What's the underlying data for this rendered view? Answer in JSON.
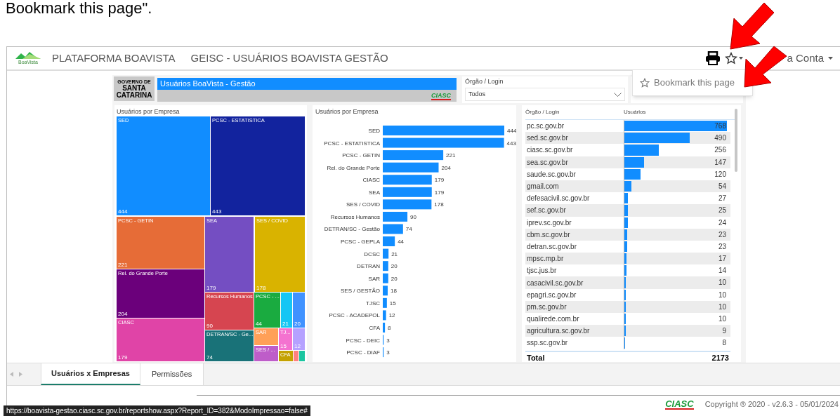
{
  "caption": "Bookmark this page\".",
  "navbar": {
    "logo_caption": "BoaVista",
    "brand": "PLATAFORMA BOAVISTA",
    "title": "GEISC - USUÁRIOS BOAVISTA GESTÃO",
    "account": "a Conta"
  },
  "bookmark_menu": {
    "item": "Bookmark this page"
  },
  "report": {
    "logo_lines": [
      "GOVERNO DE",
      "SANTA",
      "CATARINA"
    ],
    "title": "Usuários BoaVista - Gestão",
    "title_logo": "CIASC",
    "filter": {
      "label": "Órgão / Login",
      "value": "Todos"
    }
  },
  "treemap": {
    "title": "Usuários por Empresa",
    "tiles": [
      {
        "label": "SED",
        "users": "444",
        "color": "#118dff"
      },
      {
        "label": "PCSC - ESTATISTICA",
        "users": "443",
        "color": "#12239e"
      },
      {
        "label": "PCSC - GETIN",
        "users": "221",
        "color": "#e66c37"
      },
      {
        "label": "Rel. do Grande Porte",
        "users": "204",
        "color": "#6b007b"
      },
      {
        "label": "CIASC",
        "users": "179",
        "color": "#e044a7"
      },
      {
        "label": "SEA",
        "users": "179",
        "color": "#744ec2"
      },
      {
        "label": "SES / COVID",
        "users": "178",
        "color": "#d9b300"
      },
      {
        "label": "Recursos Humanos",
        "users": "90",
        "color": "#d64550"
      },
      {
        "label": "DETRAN/SC - Ge...",
        "users": "74",
        "color": "#197278"
      },
      {
        "label": "PCSC - ...",
        "users": "44",
        "color": "#1aab40"
      },
      {
        "users": "21",
        "color": "#15c6f4"
      },
      {
        "users": "20",
        "color": "#4092ff"
      },
      {
        "label": "SAR",
        "color": "#ffa058"
      },
      {
        "label": "SES / ...",
        "color": "#be5dc9"
      },
      {
        "label": "TJ...",
        "users": "15",
        "color": "#f472d0"
      },
      {
        "users": "12",
        "color": "#b5a1ff"
      },
      {
        "label": "CFA",
        "color": "#c4a200"
      },
      {
        "color": "#ff8080"
      },
      {
        "color": "#1ac5a0"
      }
    ]
  },
  "bar_chart": {
    "title": "Usuários por Empresa",
    "chart_data": {
      "type": "bar",
      "orientation": "horizontal",
      "data_labels": true,
      "categories": [
        "SED",
        "PCSC - ESTATISTICA",
        "PCSC - GETIN",
        "Rel. do Grande Porte",
        "CIASC",
        "SEA",
        "SES / COVID",
        "Recursos Humanos",
        "DETRAN/SC - Gestão",
        "PCSC - GEPLA",
        "DCSC",
        "DETRAN",
        "SAR",
        "SES / GESTÃO",
        "TJSC",
        "PCSC - ACADEPOL",
        "CFA",
        "PCSC - DEIC",
        "PCSC - DIAF"
      ],
      "series": [
        {
          "color": "#118dff",
          "values": [
            444,
            443,
            221,
            204,
            179,
            179,
            178,
            90,
            74,
            44,
            21,
            20,
            20,
            18,
            15,
            12,
            8,
            3,
            3
          ]
        }
      ]
    }
  },
  "table": {
    "columns": [
      "Órgão / Login",
      "Usuários"
    ],
    "rows": [
      {
        "login": "pc.sc.gov.br",
        "value": "768",
        "level": 1
      },
      {
        "login": "sed.sc.gov.br",
        "value": "490",
        "level": 0.638
      },
      {
        "login": "ciasc.sc.gov.br",
        "value": "256",
        "level": 0.333
      },
      {
        "login": "sea.sc.gov.br",
        "value": "147",
        "level": 0.191
      },
      {
        "login": "saude.sc.gov.br",
        "value": "120",
        "level": 0.156
      },
      {
        "login": "gmail.com",
        "value": "54",
        "level": 0.07
      },
      {
        "login": "defesacivil.sc.gov.br",
        "value": "27",
        "level": 0.035
      },
      {
        "login": "sef.sc.gov.br",
        "value": "25",
        "level": 0.033
      },
      {
        "login": "iprev.sc.gov.br",
        "value": "24",
        "level": 0.031
      },
      {
        "login": "cbm.sc.gov.br",
        "value": "23",
        "level": 0.03
      },
      {
        "login": "detran.sc.gov.br",
        "value": "23",
        "level": 0.03
      },
      {
        "login": "mpsc.mp.br",
        "value": "17",
        "level": 0.022
      },
      {
        "login": "tjsc.jus.br",
        "value": "14",
        "level": 0.018
      },
      {
        "login": "casacivil.sc.gov.br",
        "value": "10",
        "level": 0.013
      },
      {
        "login": "epagri.sc.gov.br",
        "value": "10",
        "level": 0.013
      },
      {
        "login": "pm.sc.gov.br",
        "value": "10",
        "level": 0.013
      },
      {
        "login": "qualirede.com.br",
        "value": "10",
        "level": 0.013
      },
      {
        "login": "agricultura.sc.gov.br",
        "value": "9",
        "level": 0.012
      },
      {
        "login": "ssp.sc.gov.br",
        "value": "8",
        "level": 0.01
      }
    ],
    "total": {
      "label": "Total",
      "value": "2173"
    }
  },
  "tabs": [
    {
      "label": "Usuários x Empresas",
      "selected": true
    },
    {
      "label": "Permissões",
      "selected": false
    }
  ],
  "footer": {
    "logo": "CIASC",
    "copyright": "Copyright ® 2020 - v2.6.3 - 05/01/2024"
  },
  "status_url": "https://boavista-gestao.ciasc.sc.gov.br/reportshow.aspx?Report_ID=382&ModoImpressao=false#"
}
